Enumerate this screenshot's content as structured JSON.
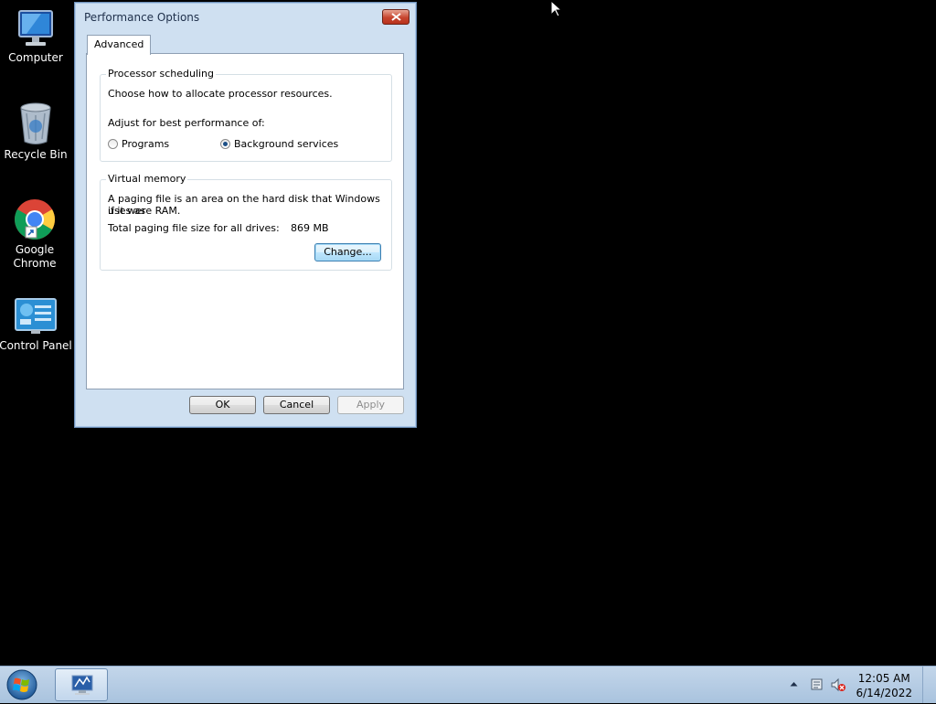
{
  "desktop": {
    "icons": [
      {
        "label": "Computer"
      },
      {
        "label": "Recycle Bin"
      },
      {
        "label": "Google Chrome"
      },
      {
        "label": "Control Panel"
      }
    ]
  },
  "dialog": {
    "title": "Performance Options",
    "tab": "Advanced",
    "processor": {
      "legend": "Processor scheduling",
      "description": "Choose how to allocate processor resources.",
      "adjust_label": "Adjust for best performance of:",
      "options": [
        {
          "label": "Programs",
          "checked": false
        },
        {
          "label": "Background services",
          "checked": true
        }
      ]
    },
    "virtual_memory": {
      "legend": "Virtual memory",
      "description_line1": "A paging file is an area on the hard disk that Windows uses as",
      "description_line2": "if it were RAM.",
      "total_label": "Total paging file size for all drives:",
      "total_value": "869 MB",
      "change_button": "Change..."
    },
    "buttons": {
      "ok": "OK",
      "cancel": "Cancel",
      "apply": "Apply"
    }
  },
  "taskbar": {
    "time": "12:05 AM",
    "date": "6/14/2022"
  },
  "colors": {
    "desktop_bg": "#000000",
    "dialog_frame": "#cfe0f1",
    "taskbar": "#b6cde5"
  }
}
